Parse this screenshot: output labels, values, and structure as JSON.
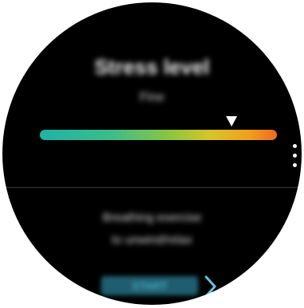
{
  "screen": {
    "title": "Stress level",
    "level": "Fine",
    "gauge": {
      "marker_position": 0.81,
      "colors": [
        "#1fb3a6",
        "#8cc63f",
        "#f0a11c",
        "#ee6a22"
      ]
    },
    "breathing_prompt_line1": "Breathing exercise",
    "breathing_prompt_line2": "to unwind/relax",
    "start_label": "START",
    "icons": {
      "next": "chevron-right-icon",
      "more": "more-options-icon"
    },
    "accent_color": "#5fc6dd"
  }
}
